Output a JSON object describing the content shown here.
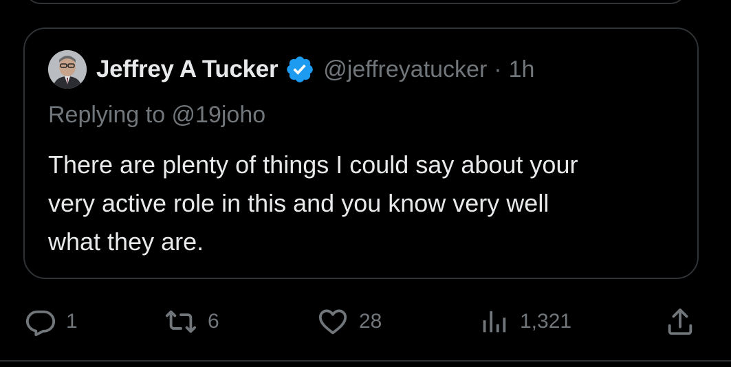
{
  "tweet": {
    "author_name": "Jeffrey A Tucker",
    "author_handle": "@jeffreyatucker",
    "separator": "·",
    "time": "1h",
    "replying_prefix": "Replying to ",
    "replying_handle": "@19joho",
    "text": "There are plenty of things I could say about your\nvery active role in this and you know very well\nwhat they are."
  },
  "actions": {
    "reply_count": "1",
    "retweet_count": "6",
    "like_count": "28",
    "views_count": "1,321"
  },
  "icons": {
    "reply": "reply-icon",
    "retweet": "retweet-icon",
    "like": "heart-icon",
    "views": "views-bar-chart-icon",
    "share": "share-icon",
    "verified": "verified-badge-icon"
  },
  "colors": {
    "background": "#000000",
    "text": "#e7e9ea",
    "secondary": "#71767b",
    "border": "#2f3336",
    "verified_blue": "#1d9bf0"
  }
}
